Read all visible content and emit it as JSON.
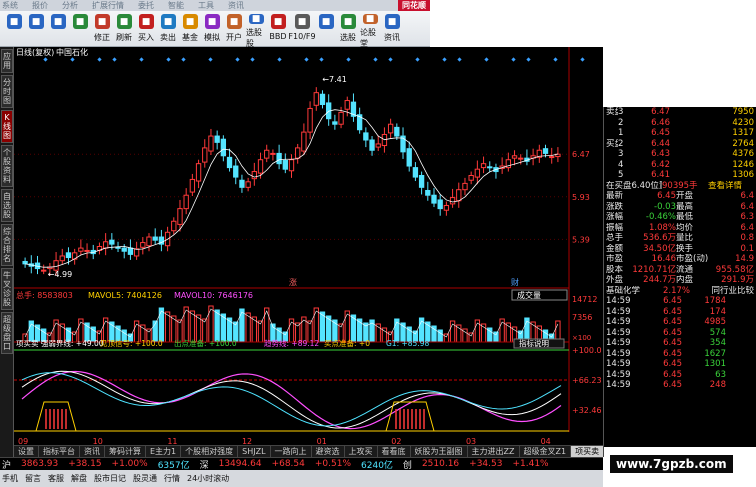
{
  "menu": [
    "系统",
    "报价",
    "分析",
    "扩展行情",
    "委托",
    "智能",
    "工具",
    "资讯"
  ],
  "logo": "同花顺",
  "toolbar": [
    {
      "label": "",
      "icon": "back-arrow-icon",
      "color": "#2a66c2"
    },
    {
      "label": "",
      "icon": "forward-arrow-icon",
      "color": "#2a66c2"
    },
    {
      "label": "",
      "icon": "home-icon",
      "color": "#2a66c2"
    },
    {
      "label": "",
      "icon": "refresh-icon",
      "color": "#2a8a3a"
    },
    {
      "label": "修正",
      "icon": "correct-icon",
      "color": "#c23a2a"
    },
    {
      "label": "刷新",
      "icon": "refresh-green-icon",
      "color": "#2a8a3a"
    },
    {
      "label": "买入",
      "icon": "buy-icon",
      "color": "#c21f1f"
    },
    {
      "label": "卖出",
      "icon": "sell-icon",
      "color": "#1f7ac2"
    },
    {
      "label": "基金",
      "icon": "fund-icon",
      "color": "#d88a00"
    },
    {
      "label": "模拟",
      "icon": "simulate-icon",
      "color": "#8a2ac2"
    },
    {
      "label": "开户",
      "icon": "account-icon",
      "color": "#c2622a"
    },
    {
      "label": "选股股",
      "icon": "pick-stock-icon",
      "color": "#2a66c2"
    },
    {
      "label": "BBD",
      "icon": "bbd-icon",
      "color": "#c21f1f"
    },
    {
      "label": "F10/F9",
      "icon": "f10-icon",
      "color": "#5a5a5a"
    },
    {
      "label": "",
      "icon": "news-icon",
      "color": "#2a66c2"
    },
    {
      "label": "选股",
      "icon": "stock-screen-icon",
      "color": "#2a8a3a"
    },
    {
      "label": "论股堂",
      "icon": "forum-icon",
      "color": "#c2622a"
    },
    {
      "label": "资讯",
      "icon": "info-icon",
      "color": "#2a66c2"
    }
  ],
  "sidebar": [
    {
      "label": "应用",
      "active": false
    },
    {
      "label": "分时图",
      "active": false
    },
    {
      "label": "K线图",
      "active": true
    },
    {
      "label": "个股资料",
      "active": false
    },
    {
      "label": "自选股",
      "active": false
    },
    {
      "label": "综合排名",
      "active": false
    },
    {
      "label": "牛叉诊股",
      "active": false
    },
    {
      "label": "超级盘口",
      "active": false
    }
  ],
  "chart_header": {
    "mode": "日线(复权)",
    "name": "中国石化"
  },
  "chart_data": {
    "type": "candlestick",
    "price_ticks": [
      "6.47",
      "5.93",
      "5.39"
    ],
    "high_label": "7.41",
    "low_label": "4.99",
    "markers": [
      "涨",
      "财"
    ],
    "closes": [
      5.08,
      5.05,
      5.02,
      5.0,
      5.04,
      5.12,
      5.18,
      5.16,
      5.22,
      5.28,
      5.25,
      5.21,
      5.3,
      5.36,
      5.33,
      5.28,
      5.24,
      5.2,
      5.27,
      5.35,
      5.42,
      5.38,
      5.33,
      5.48,
      5.62,
      5.78,
      5.95,
      6.15,
      6.35,
      6.55,
      6.7,
      6.62,
      6.45,
      6.3,
      6.18,
      6.05,
      6.12,
      6.25,
      6.4,
      6.52,
      6.48,
      6.35,
      6.28,
      6.4,
      6.55,
      6.75,
      7.05,
      7.25,
      7.1,
      6.92,
      6.85,
      7.0,
      7.15,
      6.95,
      6.78,
      6.65,
      6.52,
      6.6,
      6.72,
      6.85,
      6.7,
      6.5,
      6.32,
      6.18,
      6.05,
      5.95,
      5.85,
      5.78,
      5.82,
      5.92,
      6.02,
      6.1,
      6.2,
      6.28,
      6.35,
      6.3,
      6.25,
      6.32,
      6.4,
      6.45,
      6.42,
      6.38,
      6.45,
      6.52,
      6.48,
      6.44,
      6.47
    ],
    "volume": {
      "title": "总手: 8583803",
      "ma5_label": "MAVOL5: 7404126",
      "ma10_label": "MAVOL10: 7646176",
      "ticks": [
        "14712",
        "7356"
      ],
      "unit": "×100",
      "selector": "成交量"
    },
    "indicator": {
      "title": "项买卖 强弱界线: +49.00",
      "line2": "见顶信号: +100.0",
      "line3": "出点准备: +100.0",
      "line4": "趋势线: +89.12",
      "line5": "买点准备: +0",
      "line6": "G1: +85.98",
      "help": "指标说明",
      "ticks": [
        "+100.0",
        "+66.23",
        "+32.46"
      ]
    },
    "x_ticks": [
      "09",
      "10",
      "11",
      "12",
      "01",
      "02",
      "03",
      "04"
    ]
  },
  "bottom_tabs": [
    "设置",
    "指标平台",
    "资讯",
    "筹码计算",
    "E主力1",
    "个股相对强度",
    "SHJZL",
    "一路向上",
    "避资选",
    "上攻买",
    "看看底",
    "妖股为王副图",
    "主力进出ZZ",
    "超级金叉Z1",
    "项买卖"
  ],
  "right_panel": {
    "ask_label": "卖盘",
    "bid_label": "买盘",
    "asks": [
      {
        "level": "3",
        "price": "6.47",
        "vol": "7950"
      },
      {
        "level": "2",
        "price": "6.46",
        "vol": "4230"
      },
      {
        "level": "1",
        "price": "6.45",
        "vol": "1317"
      }
    ],
    "bids": [
      {
        "level": "2",
        "price": "6.44",
        "vol": "2764"
      },
      {
        "level": "3",
        "price": "6.43",
        "vol": "4376"
      },
      {
        "level": "4",
        "price": "6.42",
        "vol": "1246"
      },
      {
        "level": "5",
        "price": "6.41",
        "vol": "1306"
      }
    ],
    "position_note": "在买盘6.40位置有",
    "position_vol": "90395手",
    "position_link": "查看详情",
    "stats": [
      [
        "最新",
        "6.45",
        "开盘",
        "6.4"
      ],
      [
        "涨跌",
        "-0.03",
        "最高",
        "6.4"
      ],
      [
        "涨幅",
        "-0.46%",
        "最低",
        "6.3"
      ],
      [
        "振幅",
        "1.08%",
        "均价",
        "6.4"
      ],
      [
        "总手",
        "536.6万",
        "量比",
        "0.8"
      ],
      [
        "金额",
        "34.50亿",
        "换手",
        "0.1"
      ],
      [
        "市盈",
        "16.46",
        "市盈(动)",
        "14.9"
      ],
      [
        "股本",
        "1210.71亿",
        "流通",
        "955.58亿"
      ],
      [
        "外盘",
        "244.7万",
        "内盘",
        "291.9万"
      ]
    ],
    "industry": "基础化学",
    "industry_pct": "2.17%",
    "industry_link": "同行业比较",
    "ticks": [
      [
        "14:59",
        "6.45",
        "1784",
        "red"
      ],
      [
        "14:59",
        "6.45",
        "174",
        "red"
      ],
      [
        "14:59",
        "6.45",
        "4985",
        "red"
      ],
      [
        "14:59",
        "6.45",
        "574",
        "grn"
      ],
      [
        "14:59",
        "6.45",
        "354",
        "grn"
      ],
      [
        "14:59",
        "6.45",
        "1627",
        "grn"
      ],
      [
        "14:59",
        "6.45",
        "1301",
        "grn"
      ],
      [
        "14:59",
        "6.45",
        "63",
        "grn"
      ],
      [
        "14:59",
        "6.45",
        "248",
        "red"
      ]
    ]
  },
  "status": [
    {
      "text": "沪",
      "cls": "wht"
    },
    {
      "text": "3863.93",
      "cls": "red"
    },
    {
      "text": "+38.15",
      "cls": "red"
    },
    {
      "text": "+1.00%",
      "cls": "red"
    },
    {
      "text": "6357亿",
      "cls": "cyn"
    },
    {
      "text": "深",
      "cls": "wht"
    },
    {
      "text": "13494.64",
      "cls": "red"
    },
    {
      "text": "+68.54",
      "cls": "red"
    },
    {
      "text": "+0.51%",
      "cls": "red"
    },
    {
      "text": "6240亿",
      "cls": "cyn"
    },
    {
      "text": "创",
      "cls": "wht"
    },
    {
      "text": "2510.16",
      "cls": "red"
    },
    {
      "text": "+34.53",
      "cls": "red"
    },
    {
      "text": "+1.41%",
      "cls": "red"
    }
  ],
  "bottom_bar": [
    "手机",
    "留言",
    "客服",
    "解盘",
    "股市日记",
    "股灵通",
    "行情",
    "24小时滚动"
  ],
  "watermark": "www.7gpzb.com"
}
